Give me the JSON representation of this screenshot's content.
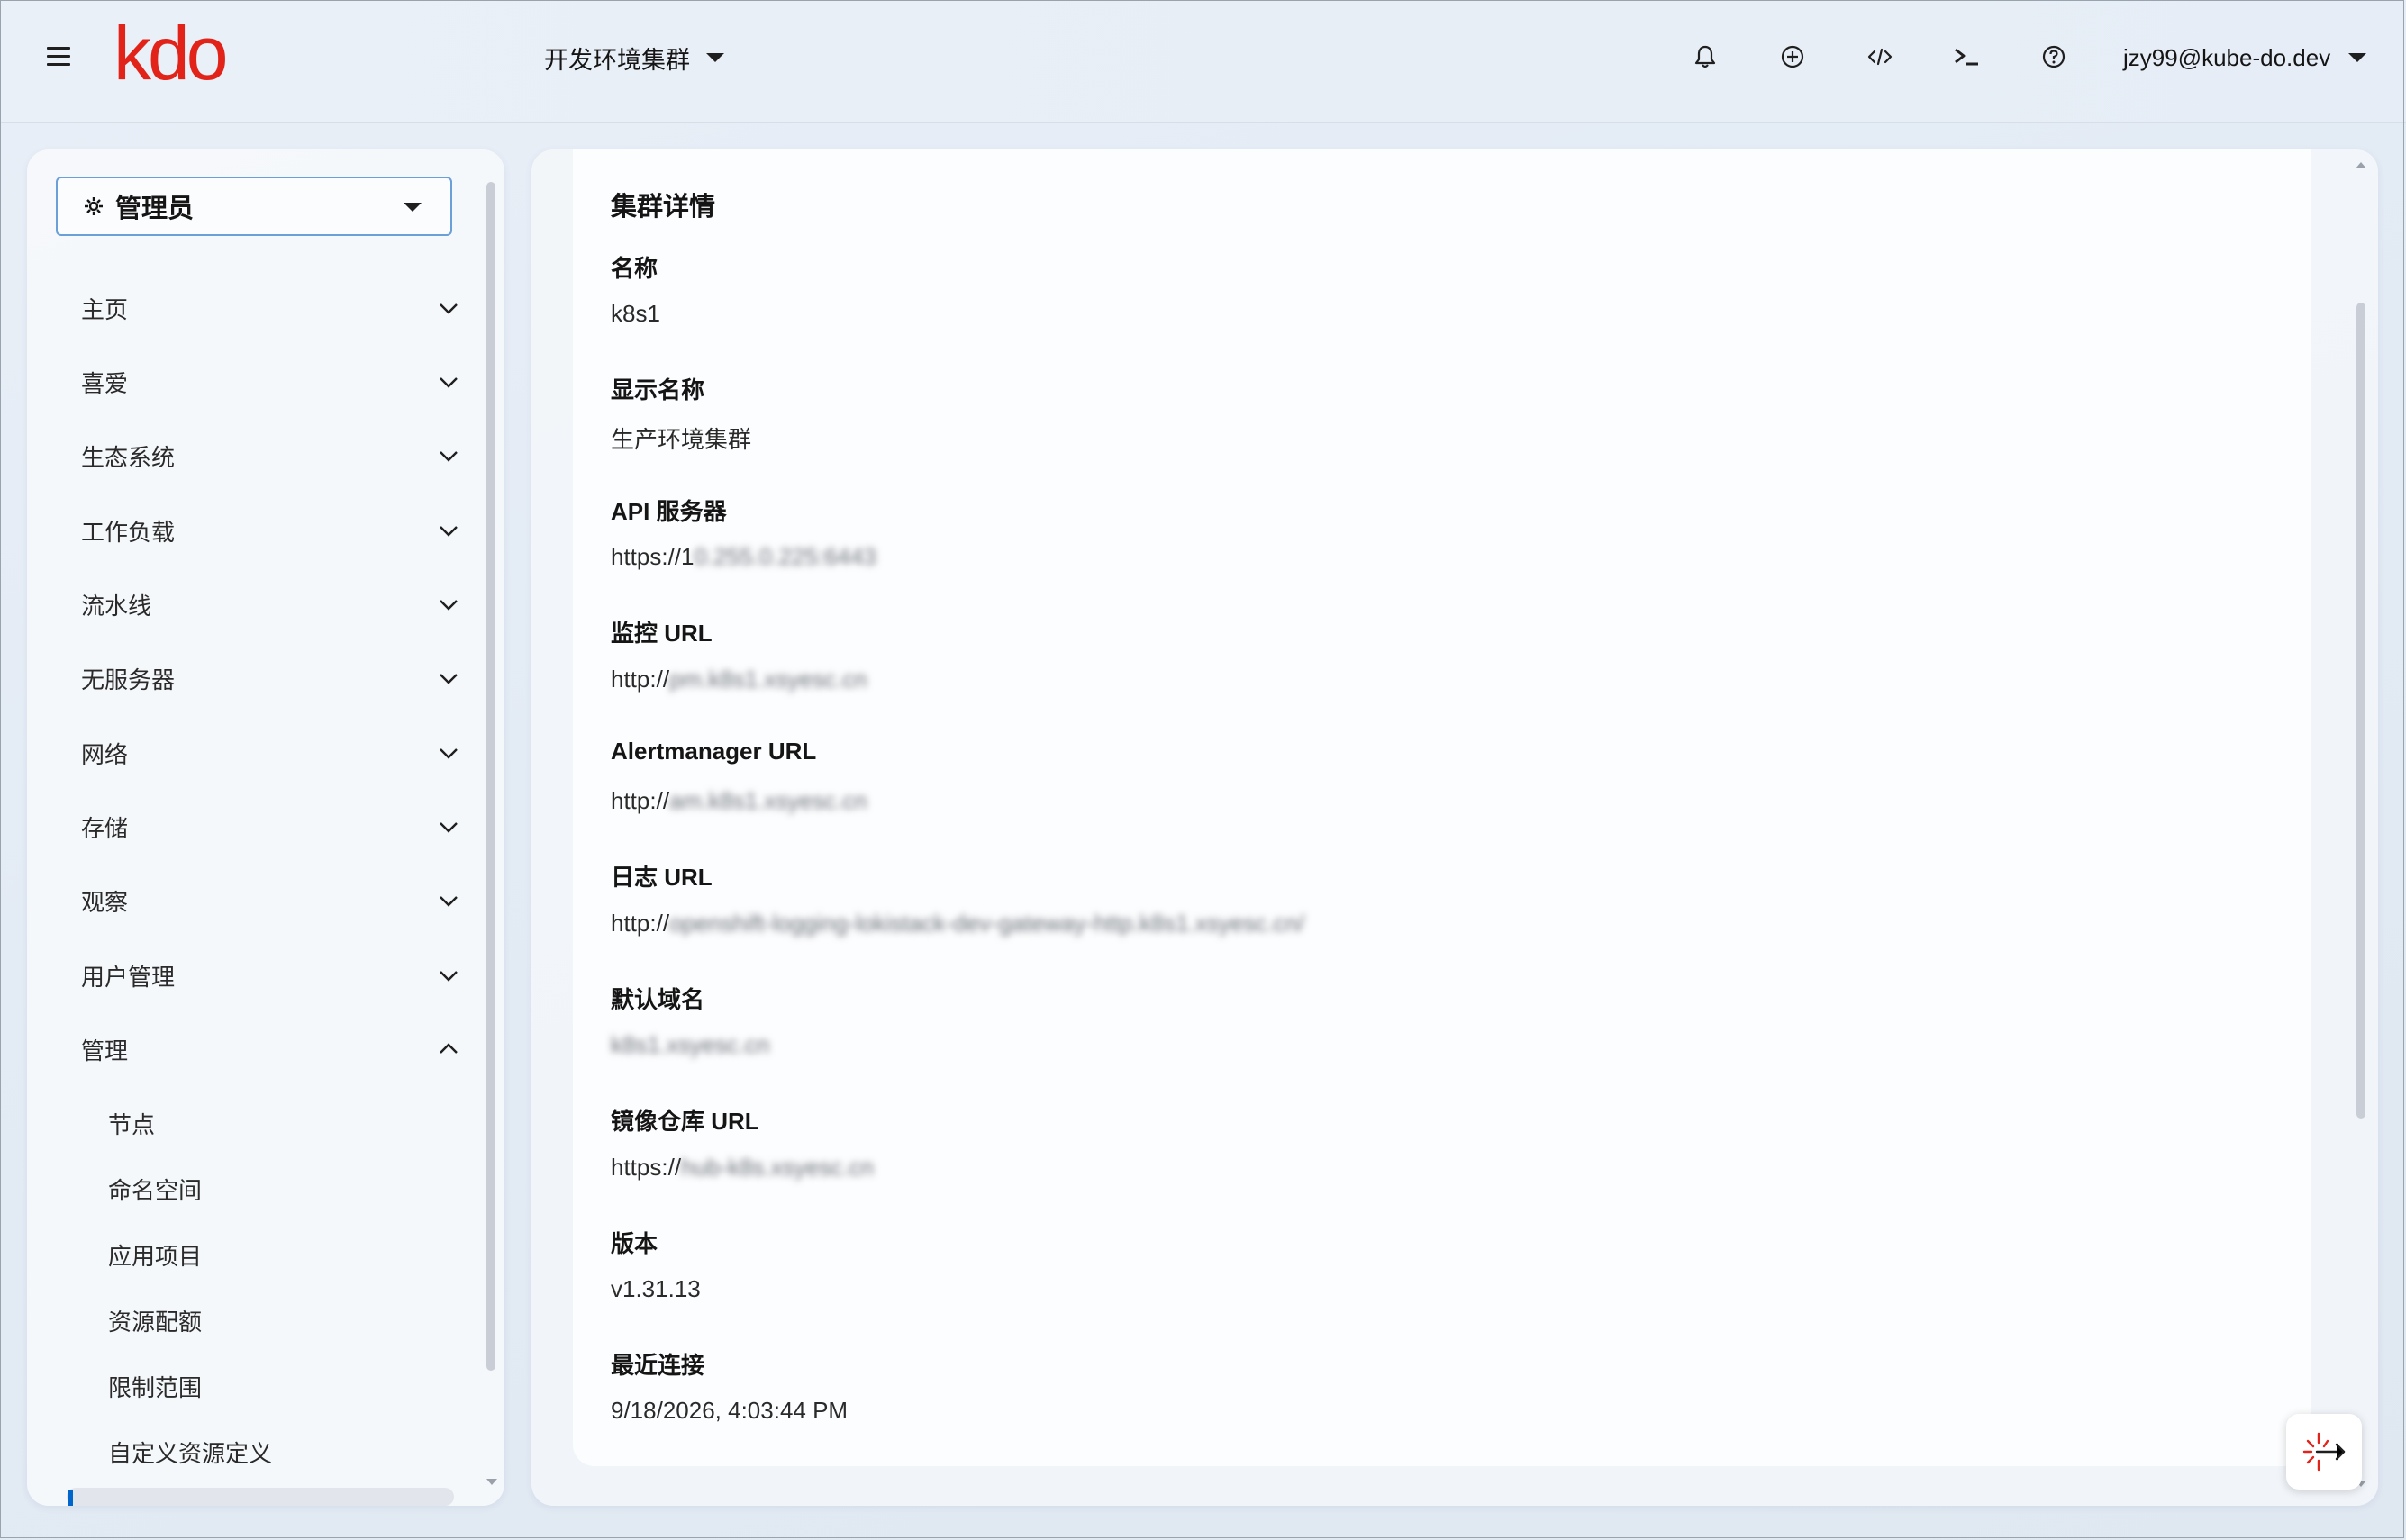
{
  "header": {
    "logo_text": "kdo",
    "cluster_name": "开发环境集群",
    "user": "jzy99@kube-do.dev",
    "icons": [
      "menu-icon",
      "bell-icon",
      "plus-circle-icon",
      "code-icon",
      "terminal-icon",
      "help-icon"
    ]
  },
  "sidebar": {
    "perspective": "管理员",
    "items": [
      {
        "label": "主页",
        "expanded": false
      },
      {
        "label": "喜爱",
        "expanded": false
      },
      {
        "label": "生态系统",
        "expanded": false
      },
      {
        "label": "工作负载",
        "expanded": false
      },
      {
        "label": "流水线",
        "expanded": false
      },
      {
        "label": "无服务器",
        "expanded": false
      },
      {
        "label": "网络",
        "expanded": false
      },
      {
        "label": "存储",
        "expanded": false
      },
      {
        "label": "观察",
        "expanded": false
      },
      {
        "label": "用户管理",
        "expanded": false
      },
      {
        "label": "管理",
        "expanded": true
      }
    ],
    "sub_items": [
      "节点",
      "命名空间",
      "应用项目",
      "资源配额",
      "限制范围",
      "自定义资源定义"
    ]
  },
  "details": {
    "title": "集群详情",
    "fields": [
      {
        "label": "名称",
        "value": "k8s1",
        "hidden": ""
      },
      {
        "label": "显示名称",
        "value": "生产环境集群",
        "hidden": ""
      },
      {
        "label": "API 服务器",
        "value": "https://1",
        "hidden": "0.255.0.225:6443"
      },
      {
        "label": "监控 URL",
        "value": "http://",
        "hidden": "pm.k8s1.xsyesc.cn"
      },
      {
        "label": "Alertmanager URL",
        "value": "http://",
        "hidden": "am.k8s1.xsyesc.cn"
      },
      {
        "label": "日志 URL",
        "value": "http://",
        "hidden": "openshift-logging-lokistack-dev-gateway-http.k8s1.xsyesc.cn/"
      },
      {
        "label": "默认域名",
        "value": "",
        "hidden": "k8s1.xsyesc.cn"
      },
      {
        "label": "镜像仓库 URL",
        "value": "https://",
        "hidden": "hub-k8s.xsyesc.cn"
      },
      {
        "label": "版本",
        "value": "v1.31.13",
        "hidden": ""
      },
      {
        "label": "最近连接",
        "value": "9/18/2026, 4:03:44 PM",
        "hidden": ""
      }
    ]
  },
  "colors": {
    "brand": "#e2231a",
    "accent": "#0066cc"
  }
}
